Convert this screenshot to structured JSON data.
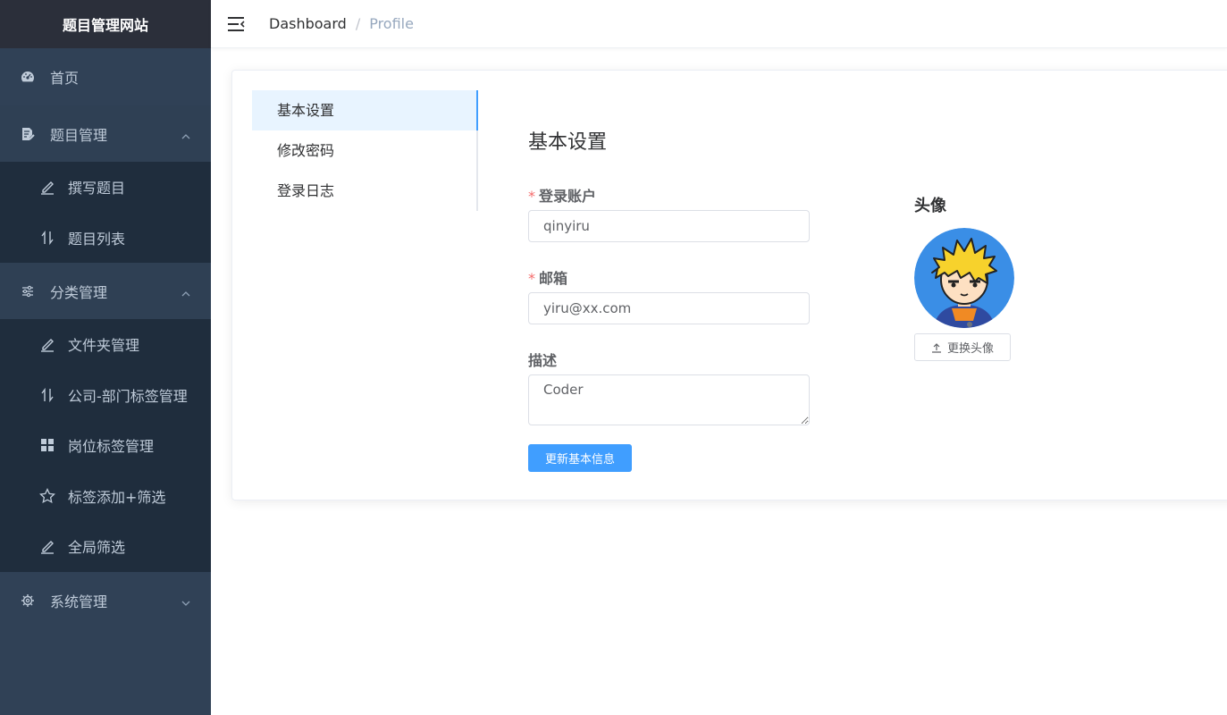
{
  "sidebar": {
    "logo": "题目管理网站",
    "home": "首页",
    "questions": {
      "label": "题目管理",
      "items": [
        "撰写题目",
        "题目列表"
      ]
    },
    "categories": {
      "label": "分类管理",
      "items": [
        "文件夹管理",
        "公司-部门标签管理",
        "岗位标签管理",
        "标签添加+筛选",
        "全局筛选"
      ]
    },
    "system": "系统管理"
  },
  "header": {
    "breadcrumb": [
      "Dashboard",
      "Profile"
    ],
    "separator": "/"
  },
  "tabs": [
    "基本设置",
    "修改密码",
    "登录日志"
  ],
  "form": {
    "title": "基本设置",
    "account": {
      "label": "登录账户",
      "value": "qinyiru",
      "required": "*"
    },
    "email": {
      "label": "邮箱",
      "value": "yiru@xx.com",
      "required": "*"
    },
    "desc": {
      "label": "描述",
      "value": "Coder"
    },
    "submit": "更新基本信息"
  },
  "avatar": {
    "label": "头像",
    "change": "更换头像"
  },
  "colors": {
    "primary": "#409eff",
    "sidebar_bg": "#304156",
    "submenu_bg": "#1f2d3d"
  }
}
